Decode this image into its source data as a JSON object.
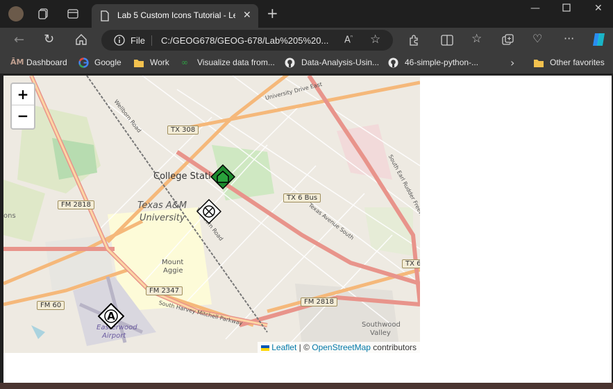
{
  "browser": {
    "tab_title": "Lab 5 Custom Icons Tutorial - Lea",
    "address_prefix": "File",
    "address_url": "C:/GEOG678/GEOG-678/Lab%205%20...",
    "window_controls": [
      "minimize",
      "maximize",
      "close"
    ]
  },
  "bookmarks": [
    {
      "label": "Dashboard",
      "icon": "tamu-icon"
    },
    {
      "label": "Google",
      "icon": "google-icon"
    },
    {
      "label": "Work",
      "icon": "folder-icon"
    },
    {
      "label": "Visualize data from...",
      "icon": "link-icon"
    },
    {
      "label": "Data-Analysis-Usin...",
      "icon": "github-icon"
    },
    {
      "label": "46-simple-python-...",
      "icon": "github-icon"
    },
    {
      "label": "Other favorites",
      "icon": "folder-icon"
    }
  ],
  "map": {
    "zoom_in": "+",
    "zoom_out": "−",
    "labels": {
      "college_station": "College Stati",
      "tamu": "Texas A&M",
      "tamu2": "University",
      "mount": "Mount",
      "aggie": "Aggie",
      "easterwood": "Easterwood",
      "airport": "Airport",
      "southwood": "Southwood",
      "valley": "Valley",
      "ons": "ons",
      "univ_dr": "University Drive East",
      "texas_ave": "Texas Avenue South",
      "harvey": "South Harvey Mitchell Parkway",
      "wellborn": "Wellborn Road",
      "wellborn2": "Wellborn Road",
      "freeway": "South Earl Rudder Freeway"
    },
    "shields": {
      "tx308": "TX 308",
      "fm2818a": "FM 2818",
      "tx6bus": "TX 6 Bus",
      "fm2347": "FM 2347",
      "fm60": "FM 60",
      "fm2818b": "FM 2818",
      "tx6": "TX 6"
    },
    "markers": {
      "airport_letter": "A"
    },
    "attribution": {
      "leaflet": "Leaflet",
      "separator": " | © ",
      "osm": "OpenStreetMap",
      "contributors": " contributors"
    }
  }
}
